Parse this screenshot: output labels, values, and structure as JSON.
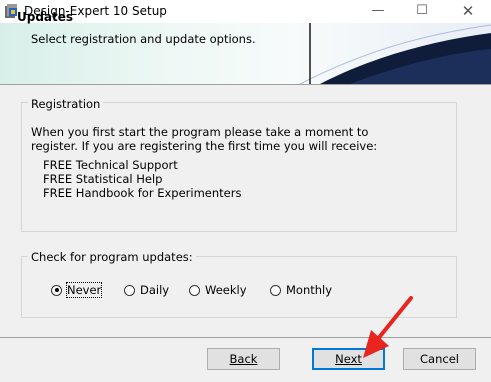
{
  "window": {
    "title": "Design-Expert 10 Setup",
    "minimize": "—",
    "maximize": "☐",
    "close": "✕"
  },
  "header": {
    "title": "Updates",
    "subtitle": "Select registration and update options."
  },
  "registration": {
    "legend": "Registration",
    "intro_line1": "When you first start the program please take a moment to",
    "intro_line2": "register. If you are registering the first time you will receive:",
    "items": [
      "FREE Technical Support",
      "FREE Statistical Help",
      "FREE Handbook for Experimenters"
    ]
  },
  "updates": {
    "legend": "Check for program updates:",
    "options": [
      "Never",
      "Daily",
      "Weekly",
      "Monthly"
    ],
    "selected": "Never"
  },
  "buttons": {
    "back": "Back",
    "next": "Next",
    "cancel": "Cancel"
  },
  "colors": {
    "accent": "#0078d7",
    "arrow": "#e8251e"
  }
}
